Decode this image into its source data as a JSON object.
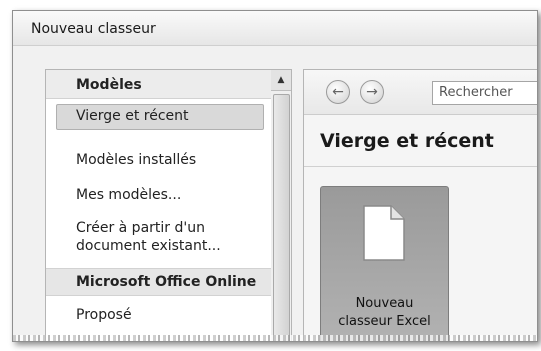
{
  "window": {
    "title": "Nouveau classeur"
  },
  "sidebar": {
    "header": "Modèles",
    "items": [
      {
        "label": "Vierge et récent",
        "selected": true
      },
      {
        "label": "Modèles installés"
      },
      {
        "label": "Mes modèles..."
      },
      {
        "label_line1": "Créer à partir d'un",
        "label_line2": "document existant..."
      }
    ],
    "section": "Microsoft Office Online",
    "section_items": [
      {
        "label": "Proposé"
      }
    ]
  },
  "toolbar": {
    "back_icon": "back-arrow-icon",
    "forward_icon": "forward-arrow-icon",
    "search_text": "Rechercher"
  },
  "main": {
    "section_title": "Vierge et récent",
    "tile": {
      "label_line1": "Nouveau",
      "label_line2": "classeur Excel",
      "icon": "blank-document-icon"
    }
  },
  "scrollbar": {
    "up_icon": "scroll-up-arrow-icon"
  }
}
